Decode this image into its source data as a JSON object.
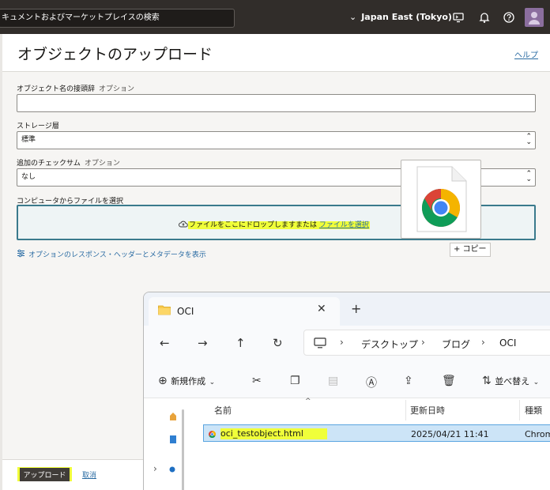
{
  "topbar": {
    "search_placeholder": "キュメントおよびマーケットプレイスの検索",
    "region": "Japan East (Tokyo)",
    "icons": [
      "cloud-shell-icon",
      "bell-icon",
      "help-icon",
      "user-avatar-icon"
    ]
  },
  "panel": {
    "title": "オブジェクトのアップロード",
    "help_link": "ヘルプ",
    "fields": {
      "prefix_label": "オブジェクト名の接頭辞",
      "prefix_optional": "オプション",
      "prefix_value": "",
      "tier_label": "ストレージ層",
      "tier_value": "標準",
      "checksum_label": "追加のチェックサム",
      "checksum_optional": "オプション",
      "checksum_value": "なし",
      "file_label": "コンピュータからファイルを選択"
    },
    "dropzone": {
      "text": "ファイルをここにドロップしますまたは",
      "browse_link": "ファイルを選択"
    },
    "options_link": "オプションのレスポンス・ヘッダーとメタデータを表示",
    "drag_copy_tip": "+ コピー",
    "footer": {
      "upload_button": "アップロード",
      "cancel_link": "取消"
    }
  },
  "explorer": {
    "tab_title": "OCI",
    "breadcrumbs": [
      "デスクトップ",
      "ブログ",
      "OCI"
    ],
    "toolbar": {
      "new_label": "新規作成",
      "sort_label": "並べ替え"
    },
    "columns": [
      "名前",
      "更新日時",
      "種類"
    ],
    "files": [
      {
        "name": "oci_testobject.html",
        "modified": "2025/04/21 11:41",
        "type": "Chrom"
      }
    ]
  },
  "colors": {
    "topbar_bg": "#312d2a",
    "link": "#2b6ca3",
    "highlight": "#f0ff3a",
    "dropzone_border": "#3a7a8c",
    "selection": "#cce4f7"
  }
}
